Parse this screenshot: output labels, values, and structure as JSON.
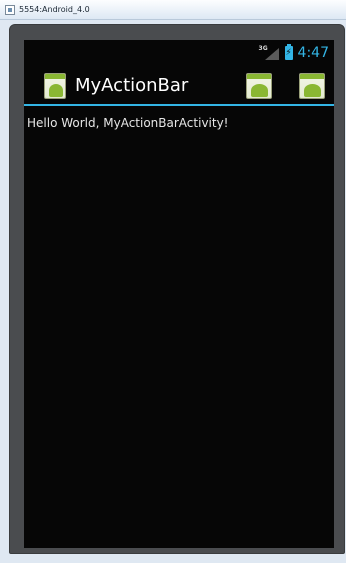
{
  "window": {
    "title": "5554:Android_4.0"
  },
  "statusbar": {
    "network_label": "3G",
    "time": "4:47",
    "accent_color": "#33b5e5"
  },
  "actionbar": {
    "title": "MyActionBar",
    "app_icon": "android-app-icon",
    "actions": [
      {
        "icon": "android-app-icon"
      },
      {
        "icon": "android-app-icon"
      }
    ]
  },
  "content": {
    "text": "Hello World, MyActionBarActivity!"
  }
}
